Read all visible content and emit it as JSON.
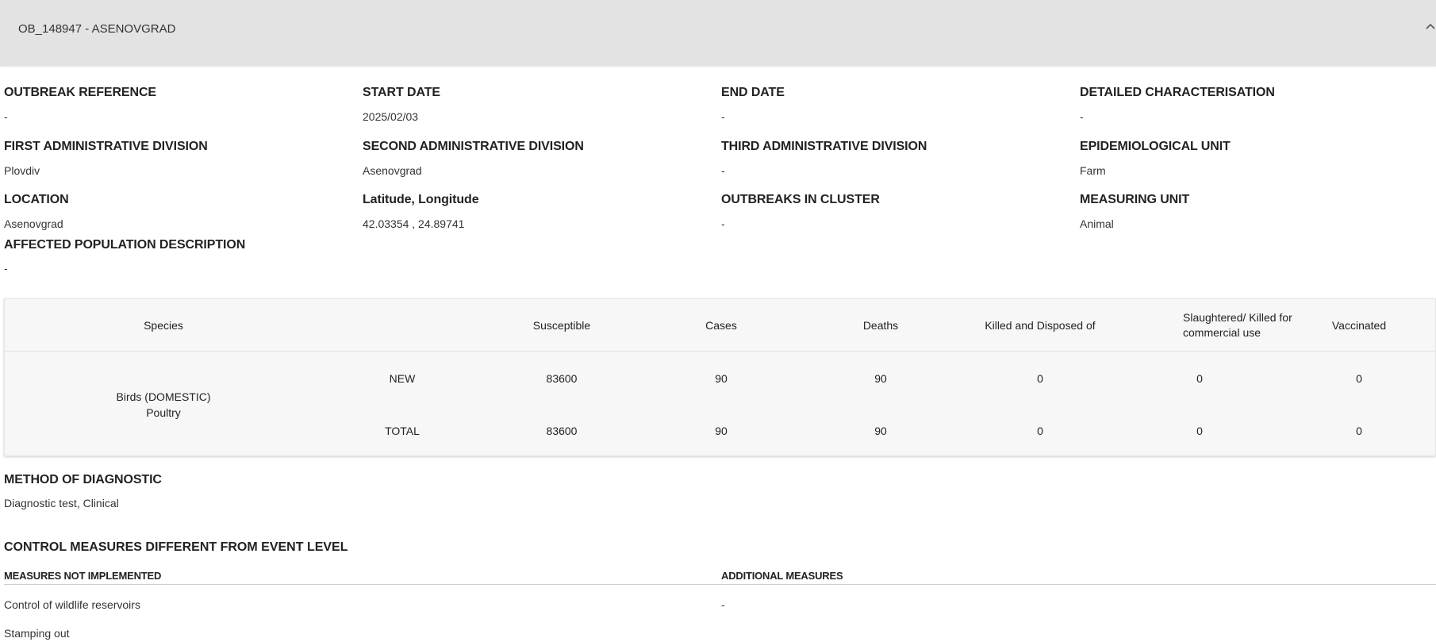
{
  "panel": {
    "title": "OB_148947 - ASENOVGRAD"
  },
  "fields": [
    {
      "label": "OUTBREAK REFERENCE",
      "value": "-"
    },
    {
      "label": "START DATE",
      "value": "2025/02/03"
    },
    {
      "label": "END DATE",
      "value": "-"
    },
    {
      "label": "DETAILED CHARACTERISATION",
      "value": "-"
    },
    {
      "label": "FIRST ADMINISTRATIVE DIVISION",
      "value": "Plovdiv"
    },
    {
      "label": "SECOND ADMINISTRATIVE DIVISION",
      "value": "Asenovgrad"
    },
    {
      "label": "THIRD ADMINISTRATIVE DIVISION",
      "value": "-"
    },
    {
      "label": "EPIDEMIOLOGICAL UNIT",
      "value": "Farm"
    },
    {
      "label": "LOCATION",
      "value": "Asenovgrad"
    },
    {
      "label": "Latitude, Longitude",
      "value": "42.03354 , 24.89741"
    },
    {
      "label": "OUTBREAKS IN CLUSTER",
      "value": "-"
    },
    {
      "label": "MEASURING UNIT",
      "value": "Animal"
    },
    {
      "label": "AFFECTED POPULATION DESCRIPTION",
      "value": "-"
    }
  ],
  "table": {
    "headers": {
      "species": "Species",
      "susceptible": "Susceptible",
      "cases": "Cases",
      "deaths": "Deaths",
      "killed": "Killed and Disposed of",
      "slaughtered": "Slaughtered/ Killed for commercial use",
      "vaccinated": "Vaccinated"
    },
    "species_line1": "Birds (DOMESTIC)",
    "species_line2": "Poultry",
    "rows": [
      {
        "type": "NEW",
        "susceptible": "83600",
        "cases": "90",
        "deaths": "90",
        "killed": "0",
        "slaughtered": "0",
        "vaccinated": "0"
      },
      {
        "type": "TOTAL",
        "susceptible": "83600",
        "cases": "90",
        "deaths": "90",
        "killed": "0",
        "slaughtered": "0",
        "vaccinated": "0"
      }
    ]
  },
  "diagnostic": {
    "label": "METHOD OF DIAGNOSTIC",
    "value": "Diagnostic test, Clinical"
  },
  "control": {
    "title": "CONTROL MEASURES DIFFERENT FROM EVENT LEVEL",
    "not_implemented_label": "MEASURES NOT IMPLEMENTED",
    "additional_label": "ADDITIONAL MEASURES",
    "not_implemented_items": [
      "Control of wildlife reservoirs",
      "Stamping out"
    ],
    "additional_value": "-"
  },
  "icons": {
    "collapse": "chevron-up-icon"
  },
  "colors": {
    "header_bg": "#e3e3e3",
    "table_bg": "#f7f7f7"
  }
}
